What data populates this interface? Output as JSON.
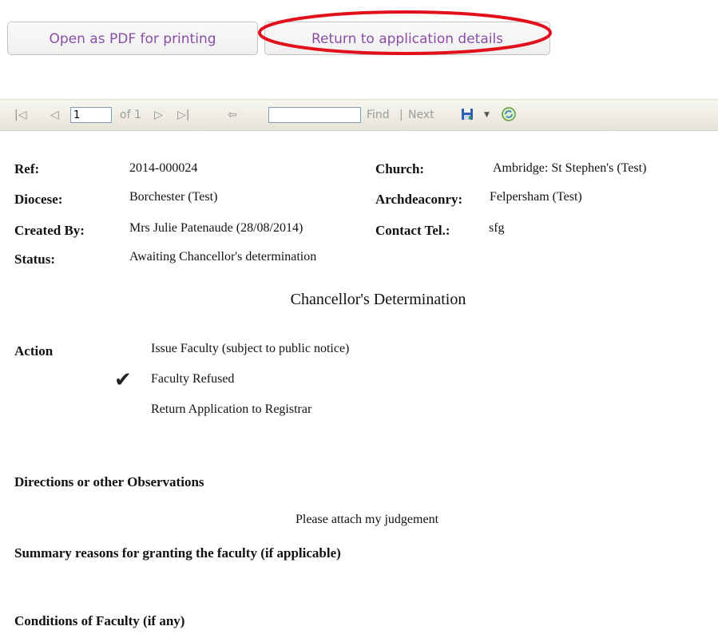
{
  "actions": {
    "open_pdf_label": "Open as PDF for printing",
    "return_label": "Return to application details"
  },
  "toolbar": {
    "first_page_icon": "first-page-icon",
    "prev_page_icon": "previous-page-icon",
    "current_page": "1",
    "of_pages": "of 1",
    "next_page_icon": "next-page-icon",
    "last_page_icon": "last-page-icon",
    "back_icon": "back-icon",
    "find_placeholder": "",
    "find_label": "Find",
    "separator": "|",
    "next_label": "Next",
    "export_icon": "save-export-icon",
    "refresh_icon": "refresh-icon"
  },
  "details": {
    "ref_label": "Ref:",
    "ref_value": "2014-000024",
    "diocese_label": "Diocese:",
    "diocese_value": "Borchester (Test)",
    "created_label": "Created By:",
    "created_value": "Mrs Julie Patenaude (28/08/2014)",
    "status_label": "Status:",
    "status_value": "Awaiting Chancellor's determination",
    "church_label": "Church:",
    "church_value": "Ambridge: St Stephen's (Test)",
    "archdeaconry_label": "Archdeaconry:",
    "archdeaconry_value": "Felpersham (Test)",
    "tel_label": "Contact Tel.:",
    "tel_value": "sfg"
  },
  "determination": {
    "title": "Chancellor's Determination",
    "action_label": "Action",
    "options": [
      {
        "label": "Issue Faculty (subject to public notice)",
        "checked": false
      },
      {
        "label": "Faculty Refused",
        "checked": true
      },
      {
        "label": "Return Application to Registrar",
        "checked": false
      }
    ],
    "check_glyph": "✔",
    "directions_label": "Directions or other Observations",
    "directions_value": "Please attach my judgement",
    "summary_label": "Summary reasons for granting the faculty (if applicable)",
    "conditions_label": "Conditions of Faculty (if any)"
  },
  "colors": {
    "button_text": "#8a4fa3",
    "highlight_ring": "#e0101c",
    "toolbar_bg": "#ebe9dd"
  }
}
